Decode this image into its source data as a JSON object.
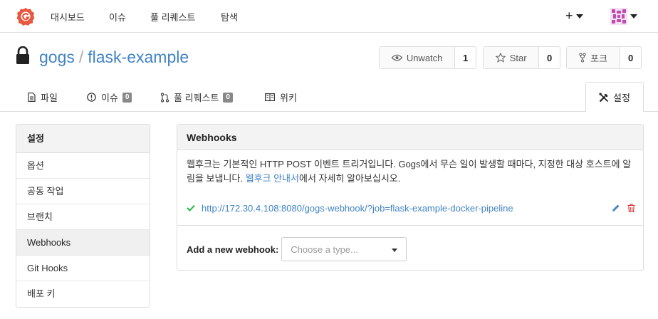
{
  "nav": {
    "items": [
      "대시보드",
      "이슈",
      "풀 리퀘스트",
      "탐색"
    ],
    "plus": "+"
  },
  "repo": {
    "owner": "gogs",
    "separator": "/",
    "name": "flask-example",
    "watch": {
      "label": "Unwatch",
      "count": "1"
    },
    "star": {
      "label": "Star",
      "count": "0"
    },
    "fork": {
      "label": "포크",
      "count": "0"
    }
  },
  "tabs": {
    "files": "파일",
    "issues": {
      "label": "이슈",
      "count": "0"
    },
    "pulls": {
      "label": "풀 리퀘스트",
      "count": "0"
    },
    "wiki": "위키",
    "settings": "설정"
  },
  "sidebar": {
    "title": "설정",
    "items": [
      "옵션",
      "공동 작업",
      "브랜치",
      "Webhooks",
      "Git Hooks",
      "배포 키"
    ],
    "active_index": 3
  },
  "webhooks": {
    "title": "Webhooks",
    "desc_part1": "웹후크는 기본적인 HTTP POST 이벤트 트리거입니다. Gogs에서 무슨 일이 발생할 때마다, 지정한 대상 호스트에 알림을 보냅니다. ",
    "desc_link": "웹후크 안내서",
    "desc_part2": "에서 자세히 알아보십시오.",
    "hook_url": "http://172.30.4.108:8080/gogs-webhook/?job=flask-example-docker-pipeline",
    "add_label": "Add a new webhook:",
    "select_placeholder": "Choose a type..."
  },
  "colors": {
    "link": "#4183c4",
    "success": "#21ba45",
    "danger": "#db2828",
    "logo": "#e8573f"
  }
}
